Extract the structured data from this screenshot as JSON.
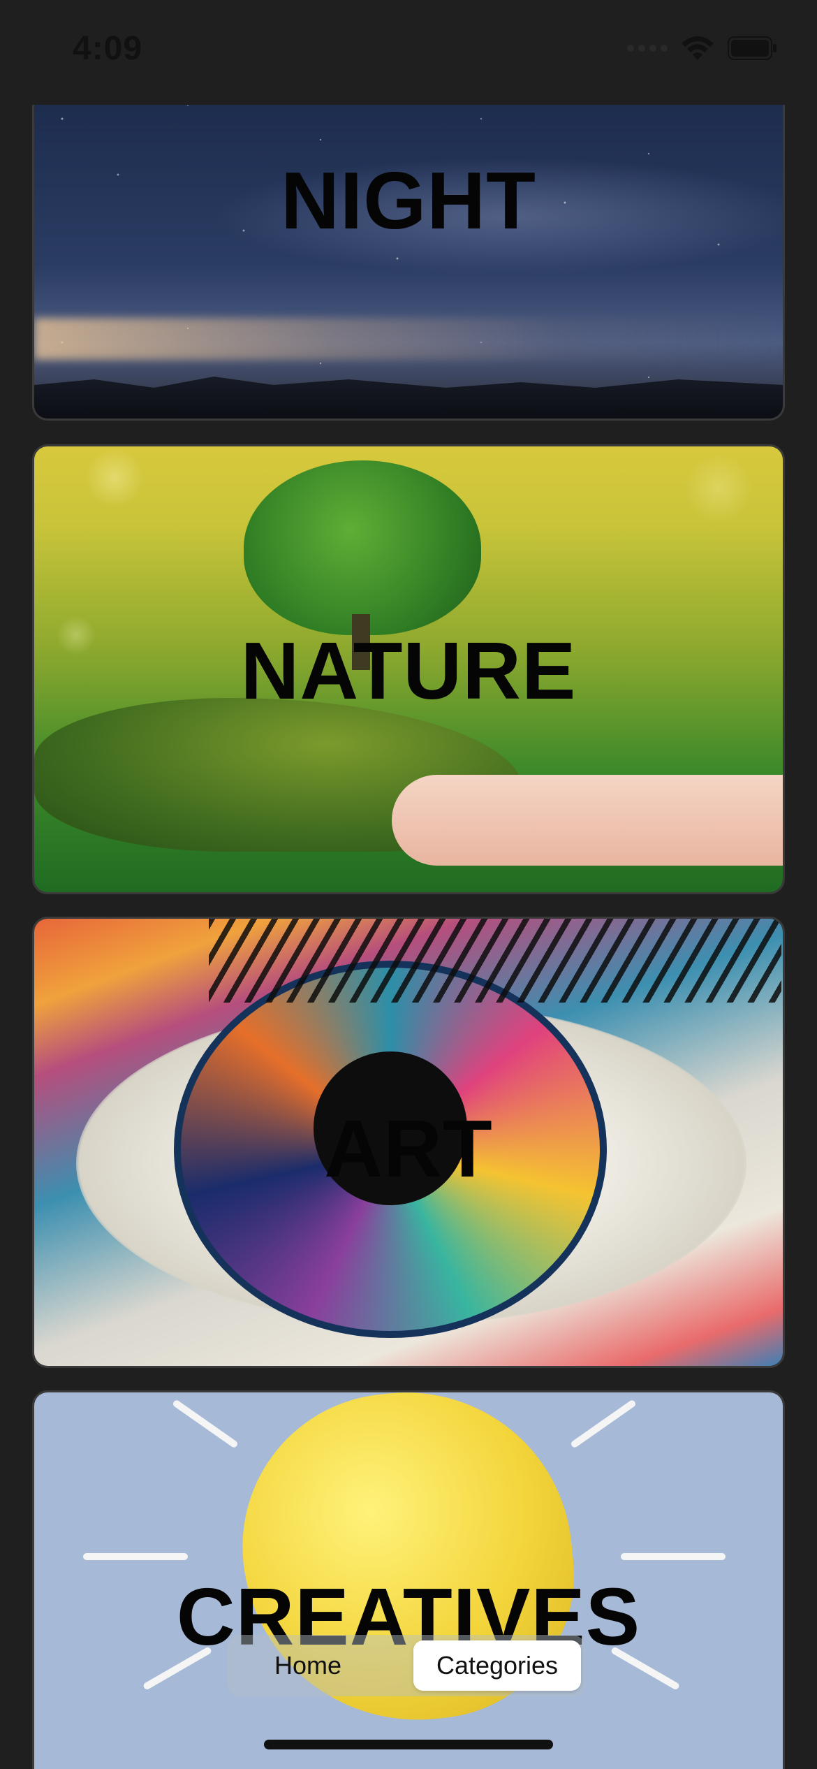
{
  "status_bar": {
    "time": "4:09"
  },
  "categories": [
    {
      "title": "NIGHT"
    },
    {
      "title": "NATURE"
    },
    {
      "title": "ART"
    },
    {
      "title": "CREATIVES"
    }
  ],
  "tab_bar": {
    "tabs": [
      {
        "label": "Home",
        "selected": false
      },
      {
        "label": "Categories",
        "selected": true
      }
    ]
  },
  "icons": {
    "wifi": "wifi-icon",
    "battery": "battery-icon",
    "signal": "cellular-signal-icon"
  }
}
